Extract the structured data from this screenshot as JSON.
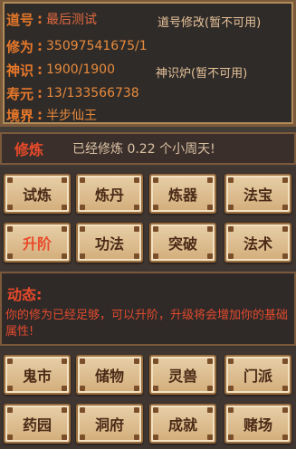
{
  "status": {
    "daohao_label": "道号",
    "daohao_value": "最后测试",
    "daohao_action": "道号修改(暂不可用)",
    "xiuwei_label": "修为",
    "xiuwei_value": "35097541675/1",
    "shenshi_label": "神识",
    "shenshi_value": "1900/1900",
    "shenshi_action": "神识炉(暂不可用)",
    "shouyuan_label": "寿元",
    "shouyuan_value": "13/133566738",
    "jingjie_label": "境界",
    "jingjie_value": "半步仙王"
  },
  "cultivation": {
    "title": "修炼",
    "text": "已经修炼 0.22 个小周天!"
  },
  "actions_top": [
    {
      "label": "试炼",
      "active": false
    },
    {
      "label": "炼丹",
      "active": false
    },
    {
      "label": "炼器",
      "active": false
    },
    {
      "label": "法宝",
      "active": false
    },
    {
      "label": "升阶",
      "active": true
    },
    {
      "label": "功法",
      "active": false
    },
    {
      "label": "突破",
      "active": false
    },
    {
      "label": "法术",
      "active": false
    }
  ],
  "dynamics": {
    "title": "动态:",
    "text": "你的修为已经足够，可以升阶，升级将会增加你的基础属性!"
  },
  "actions_bottom": [
    {
      "label": "鬼市"
    },
    {
      "label": "储物"
    },
    {
      "label": "灵兽"
    },
    {
      "label": "门派"
    },
    {
      "label": "药园"
    },
    {
      "label": "洞府"
    },
    {
      "label": "成就"
    },
    {
      "label": "赌场"
    }
  ],
  "colors": {
    "label_orange": "#e7782a",
    "accent_red": "#e84a2a",
    "button_bg": "#e7cfa7"
  }
}
